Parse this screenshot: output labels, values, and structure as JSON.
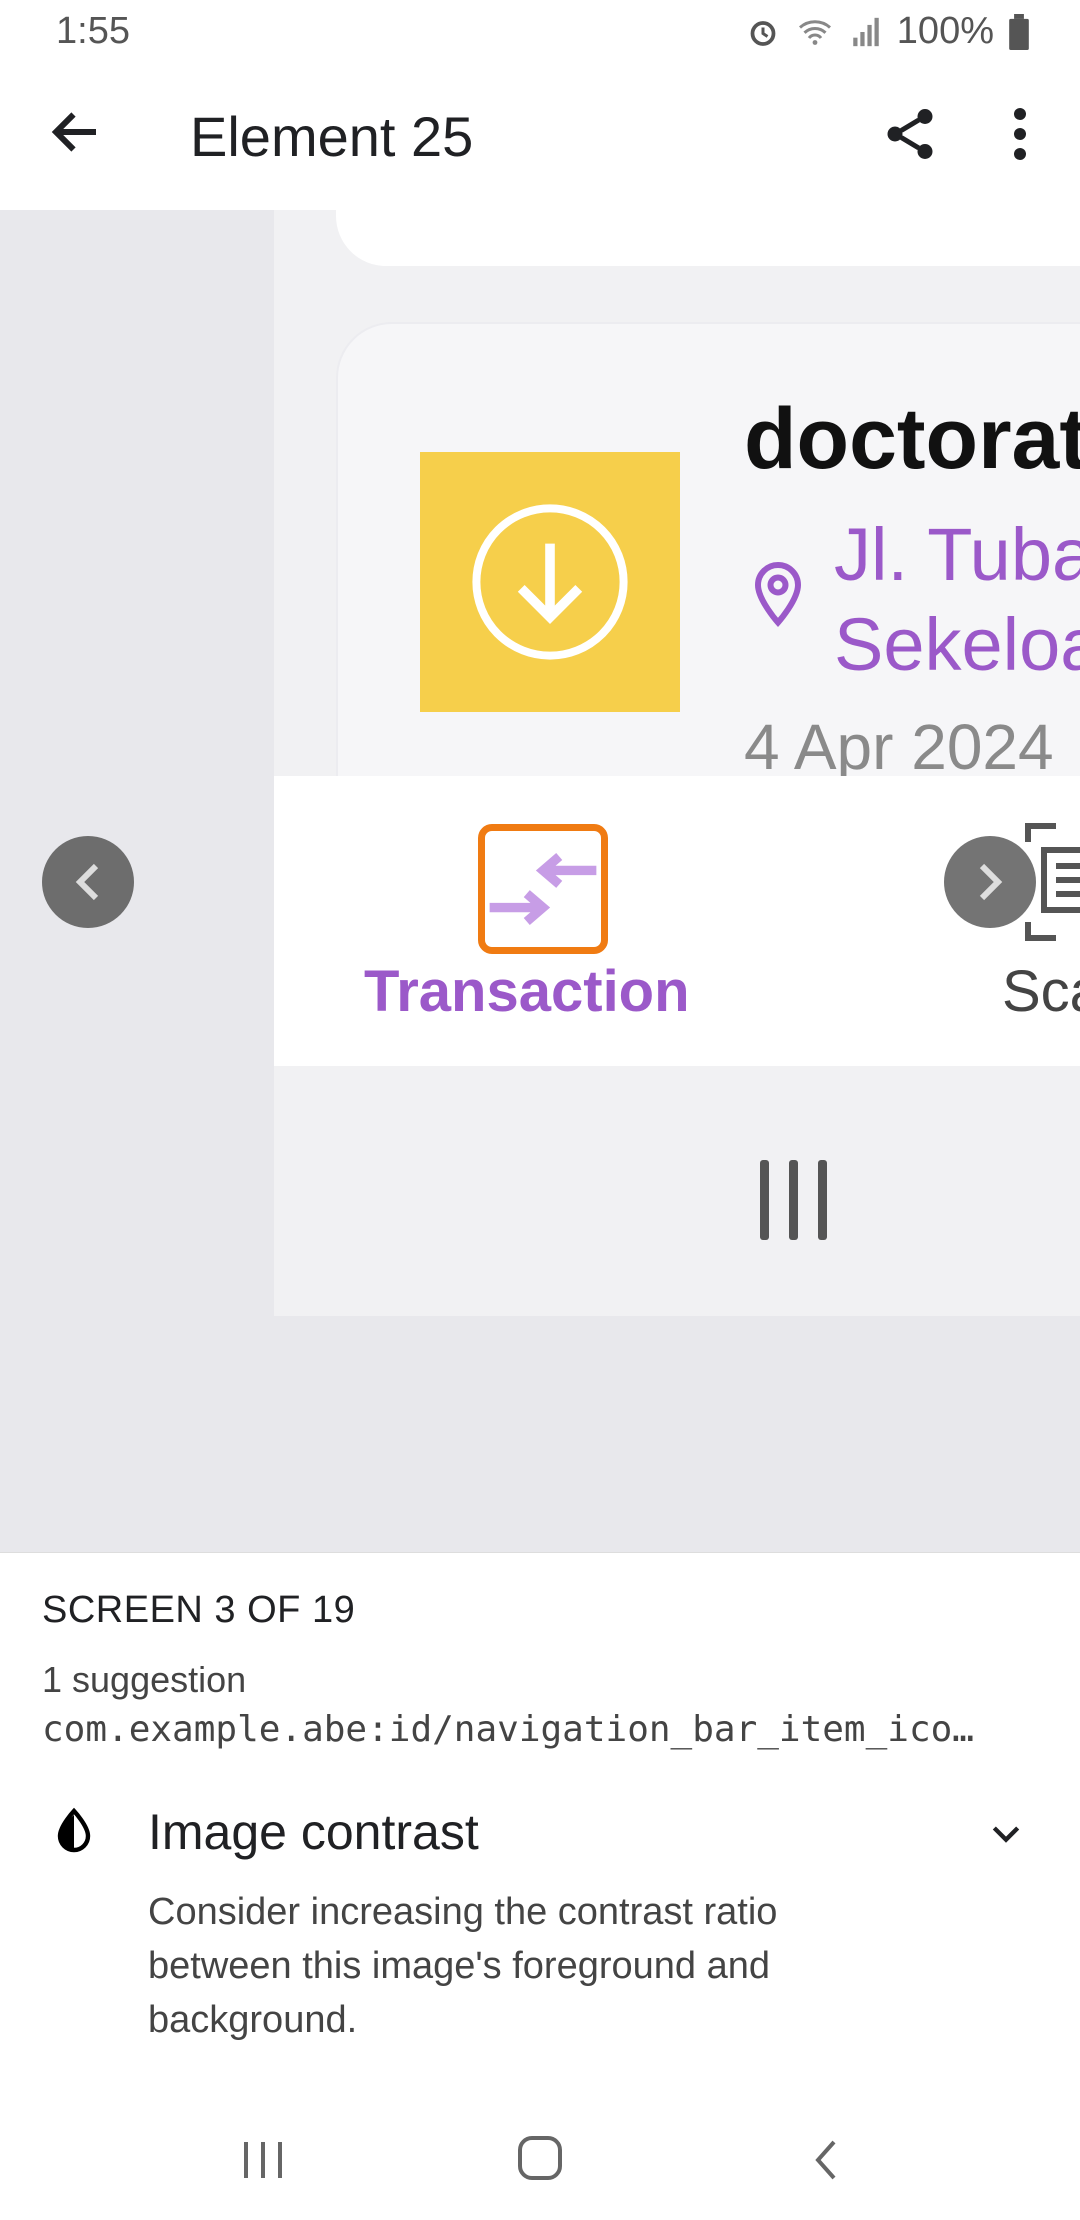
{
  "status_bar": {
    "time": "1:55",
    "battery": "100%"
  },
  "app_bar": {
    "title": "Element 25"
  },
  "preview": {
    "card_title": "doctorat",
    "address_line1": "Jl. Tuba",
    "address_line2": "Sekeloa",
    "date": "4 Apr 2024",
    "nav_label_active": "Transaction",
    "nav_label_next": "Sca",
    "accent_color": "#9b59c9",
    "highlight_color": "#f07b12",
    "yellow_color": "#f6cf4b"
  },
  "panel": {
    "screen_count": "SCREEN 3 OF 19",
    "suggestion_count": "1 suggestion",
    "resource_id": "com.example.abe:id/navigation_bar_item_ico…",
    "issue_title": "Image contrast",
    "issue_description": "Consider increasing the contrast ratio between this image's foreground and background."
  }
}
